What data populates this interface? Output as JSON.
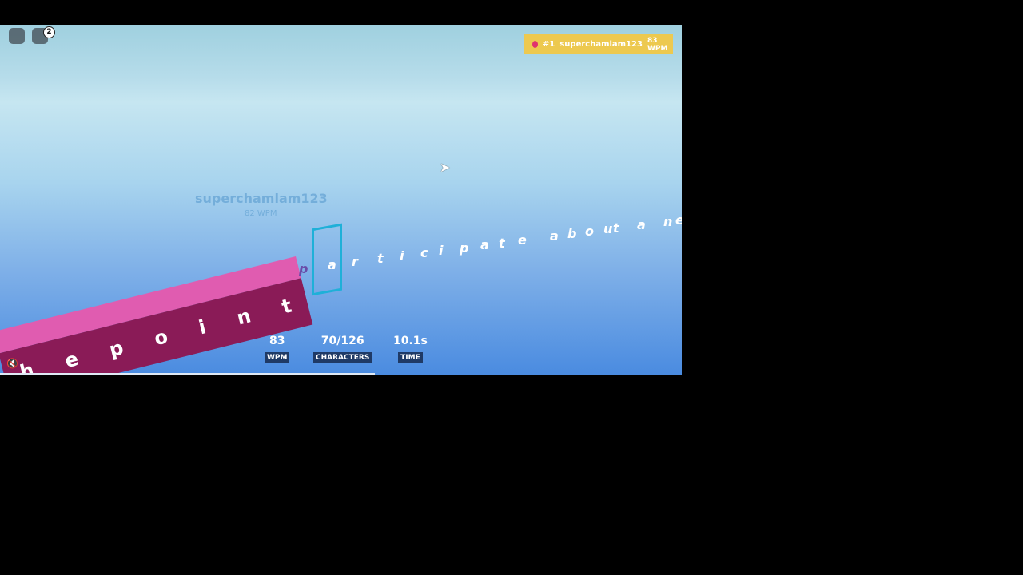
{
  "toolbar": {
    "notification_count": "2"
  },
  "leaderboard": {
    "rank": "#1",
    "player": "superchamlam123",
    "wpm": "83 WPM",
    "dot_color": "#e0336e"
  },
  "ghost": {
    "name": "superchamlam123",
    "wpm": "82 WPM"
  },
  "track_letters": [
    "h",
    "e",
    "p",
    "o",
    "i",
    "n",
    "t"
  ],
  "floating_letters": [
    "p",
    "a",
    "r",
    "t",
    "i",
    "c",
    "i",
    "p",
    "a",
    "t",
    "e",
    "a",
    "b",
    "o",
    "u",
    "t",
    "a",
    "n",
    "e"
  ],
  "stats": {
    "wpm_value": "83",
    "wpm_label": "WPM",
    "chars_value": "70/126",
    "chars_label": "CHARACTERS",
    "time_value": "10.1s",
    "time_label": "TIME"
  },
  "progress": 0.55
}
